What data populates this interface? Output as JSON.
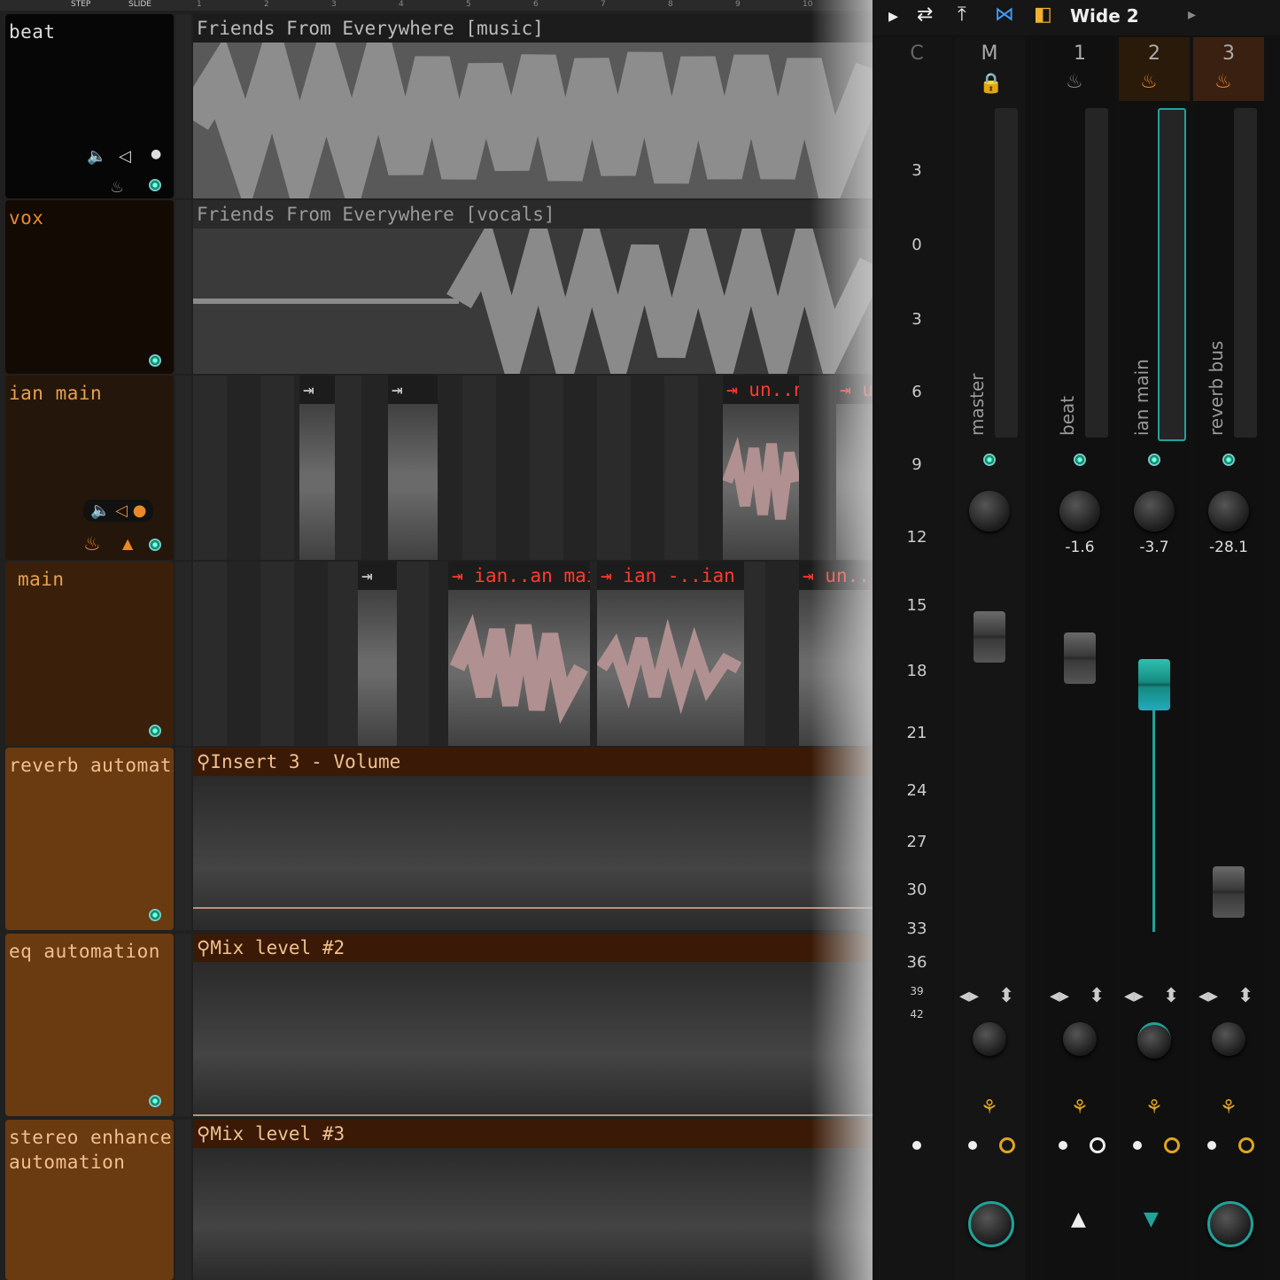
{
  "ruler": {
    "ticks": [
      "1",
      "2",
      "3",
      "4",
      "5",
      "6",
      "7",
      "8",
      "9",
      "10"
    ],
    "left_labels": [
      "STEP",
      "SLIDE"
    ]
  },
  "tracks": [
    {
      "name": "beat"
    },
    {
      "name": "vox"
    },
    {
      "name": "ian main"
    },
    {
      "name": "main"
    },
    {
      "name": "reverb automation"
    },
    {
      "name": "eq automation"
    },
    {
      "name": "stereo enhancer",
      "name2": "automation"
    }
  ],
  "clips": {
    "music": "Friends From Everywhere [music]",
    "vocals": "Friends From Everywhere [vocals]",
    "un_n": "un..n",
    "u": "u",
    "ian_an_main": "ian..an main",
    "ian_ian_main": "ian -..ian main",
    "un_dots": "un..",
    "insert3": "Insert 3 - Volume",
    "mix2": "Mix level #2",
    "mix3": "Mix level #3"
  },
  "mixer": {
    "title": "Wide 2",
    "scale": [
      "C",
      "3",
      "0",
      "3",
      "6",
      "9",
      "12",
      "15",
      "18",
      "21",
      "24",
      "27",
      "30",
      "33",
      "36",
      "39",
      "42"
    ],
    "channels": [
      {
        "num": "M",
        "label": "master",
        "volume": ""
      },
      {
        "num": "1",
        "label": "beat",
        "volume": "-1.6"
      },
      {
        "num": "2",
        "label": "ian main",
        "volume": "-3.7"
      },
      {
        "num": "3",
        "label": "reverb bus",
        "volume": "-28.1"
      }
    ]
  },
  "colors": {
    "accent_teal": "#1fa39a",
    "accent_orange": "#e8892a",
    "clip_red": "#ff3b2f"
  }
}
